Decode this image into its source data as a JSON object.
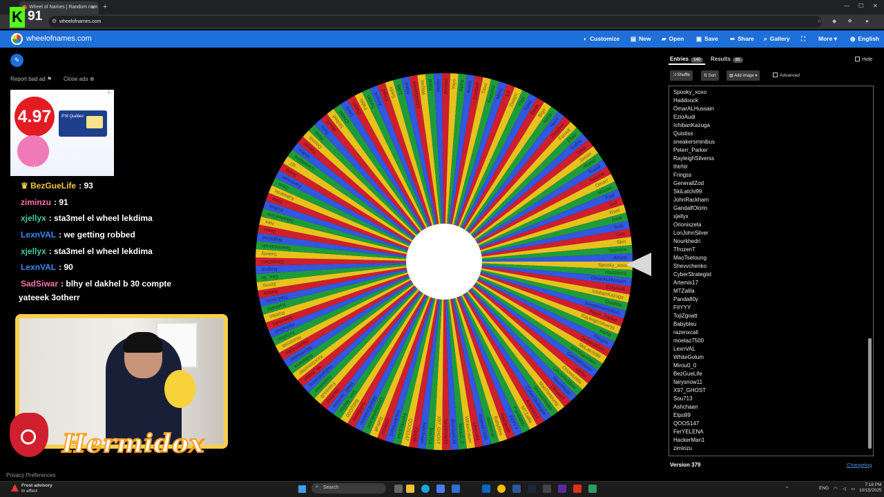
{
  "browser": {
    "tab_title": "Wheel of Names | Random nam",
    "url": "wheelofnames.com"
  },
  "kick_badge": {
    "letter": "K",
    "count": "91"
  },
  "site": {
    "name": "wheelofnames.com",
    "menu": [
      "Customize",
      "New",
      "Open",
      "Save",
      "Share",
      "Gallery",
      "More",
      "English"
    ]
  },
  "ad": {
    "report": "Report bad ad",
    "close": "Close ads",
    "price": "4.97",
    "brand": "P'tit Québec",
    "tag": "i▷"
  },
  "chat": [
    {
      "user": "fairysnow11",
      "text": "91",
      "color": "#b0a0ff"
    },
    {
      "user": "BezGueLife",
      "text": "93",
      "color": "#f6c945",
      "crown": true
    },
    {
      "user": "ziminzu",
      "text": "91",
      "color": "#ff6fb3"
    },
    {
      "user": "xjellyx",
      "text": "sta3mel el wheel lekdima",
      "color": "#3fd0a5"
    },
    {
      "user": "LexnVAL",
      "text": "we getting robbed",
      "color": "#3d8df0"
    },
    {
      "user": "xjellyx",
      "text": "sta3mel el wheel lekdima",
      "color": "#3fd0a5"
    },
    {
      "user": "LexnVAL",
      "text": "90",
      "color": "#3d8df0"
    },
    {
      "user": "SadSiwar",
      "text": "blhy el dakhel b 30 compte",
      "color": "#ff6fb3"
    },
    {
      "user": "",
      "text": "yateeek 3otherr",
      "color": "#fff"
    }
  ],
  "overlay_user": "ziminzu",
  "streamer_name": "Hermidox",
  "privacy": "Privacy Preferences",
  "wheel": {
    "colors": [
      "#e8c21c",
      "#1f9c3a",
      "#3257e0",
      "#cf1f2d"
    ],
    "names": [
      "Spooky_xoxo",
      "Haddoock",
      "OmarALHussain",
      "EzioAudi",
      "IchibanKazuga",
      "Quistiss",
      "sneakersminibus",
      "Peterr_Parker",
      "RayleighSilverss",
      "thtrhtr",
      "Fringss",
      "GenerallZod",
      "SkiLatchi99",
      "JohnRackham",
      "GandalfOlorin",
      "xjellyx",
      "Orioniszeta",
      "LonJohnSilver",
      "Nourkhedri",
      "TfrozenT",
      "MaoTsetoung",
      "Shevvchenko",
      "CyberStrategist",
      "Artemis17",
      "MTZalila",
      "Panda80y",
      "FIIYYY",
      "TojiZgoatt",
      "Babybleu",
      "razenxcali",
      "moetaz7500",
      "LexnVAL",
      "WhiteGolum",
      "Mirou0_0",
      "BezGueLife",
      "fairysnow11",
      "X97_GHOST",
      "Sou713",
      "Ashchaan",
      "Elpo99",
      "QOOS147",
      "FerYELENA",
      "HackerMan1",
      "ziminzu",
      "Raffraff",
      "ChristopheLeco",
      "AlbertEinsteinn",
      "SoNSiwar",
      "BabyG00",
      "Don_Marlon",
      "Weld_Jackson",
      "Skullyyy",
      "Fawzou9",
      "Assoulous",
      "Haitamhsama",
      "Mr_Robot",
      "KickStreamer",
      "Bellafanta",
      "NiceWorker",
      "HazemJobs",
      "Horroriste",
      "Kr1sTox",
      "AlphaDad",
      "Sanosuke",
      "Romeo",
      "KaMaRo",
      "TheCinotic",
      "Batata",
      "Jimmy",
      "Sea_3b",
      "Ragnar",
      "GhostZero",
      "Sweety",
      "TeamNoBrain",
      "NightOwl",
      "Zinou",
      "Nex",
      "TalkativeOne",
      "Koftaa",
      "Ssaa",
      "Kaiwarou",
      "Zeus",
      "Fantomas",
      "Teqila",
      "sl7",
      "LunaAlpha",
      "Vodka",
      "Falcon",
      "Dounia",
      "Rixie",
      "Toxic",
      "Moul3",
      "Sinbad",
      "Cheb9",
      "Doxx",
      "Zlatan",
      "Pablo",
      "Tarzan",
      "AnonX",
      "KingZ",
      "Sadix",
      "Lokk",
      "Hana",
      "MrMohamed",
      "Wayne",
      "Koral",
      "Vector",
      "Ahmed",
      "Yoyo",
      "Alpha",
      "Rasta",
      "ZomboX",
      "Titou",
      "Kazuma",
      "Mimz",
      "Lili",
      "Zwayri",
      "Papi",
      "Tunsi",
      "Reda",
      "Bigo",
      "Nouz",
      "Noxx",
      "Zinedine",
      "Farouk",
      "Elias",
      "Gafsa",
      "Tahar",
      "Jasser",
      "Ramzi",
      "Raouf",
      "Yassine",
      "Omarr",
      "Mouna",
      "Fadi",
      "Seif",
      "Wael",
      "Hedi",
      "Iheb",
      "Ons",
      "Slim",
      "Yasmine",
      "Amine"
    ],
    "pointer": "pointer-arrow"
  },
  "panel": {
    "tabs": [
      {
        "label": "Entries",
        "count": "140"
      },
      {
        "label": "Results",
        "count": "85"
      }
    ],
    "hide_label": "Hide",
    "buttons": [
      "Shuffle",
      "Sort",
      "Add image"
    ],
    "advanced_label": "Advanced",
    "entries": [
      "Spooky_xoxo",
      "Haddoock",
      "OmarALHussain",
      "EzioAudi",
      "IchibanKazuga",
      "Quistiss",
      "sneakersminibus",
      "Peterr_Parker",
      "RayleighSilverss",
      "thtrhtr",
      "Fringss",
      "GenerallZod",
      "SkiLatchi99",
      "JohnRackham",
      "GandalfOlorin",
      "xjellyx",
      "Orioniszeta",
      "LonJohnSilver",
      "Nourkhedri",
      "TfrozenT",
      "MaoTsetoung",
      "Shevvchenko",
      "CyberStrategist",
      "Artemis17",
      "MTZalila",
      "Panda80y",
      "FIIYYY",
      "TojiZgoatt",
      "Babybleu",
      "razenxcali",
      "moetaz7500",
      "LexnVAL",
      "WhiteGolum",
      "Mirou0_0",
      "BezGueLife",
      "fairysnow11",
      "X97_GHOST",
      "Sou713",
      "Ashchaan",
      "Elpo99",
      "QOOS147",
      "FerYELENA",
      "HackerMan1",
      "ziminzu"
    ],
    "version": "Version 379",
    "changelog": "Changelog"
  },
  "taskbar": {
    "weather_title": "Frost advisory",
    "weather_sub": "In effect",
    "search": "Search",
    "lang": "ENG",
    "time": "7:18 PM",
    "date": "10/15/2025"
  }
}
